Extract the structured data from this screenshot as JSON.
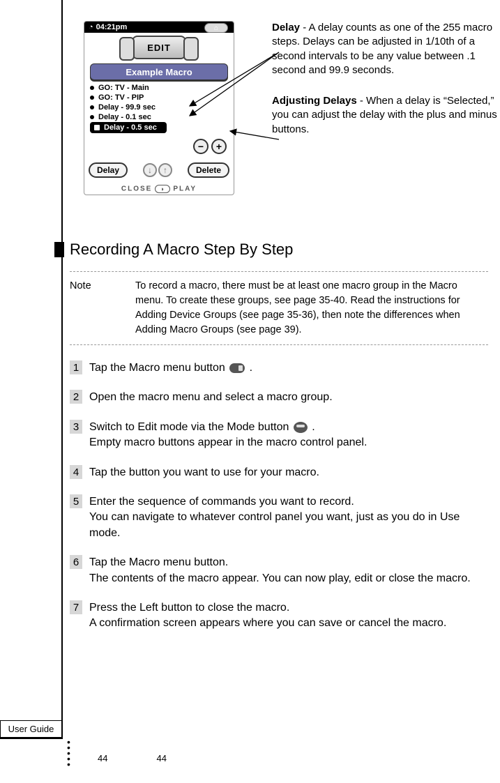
{
  "tab_label": "User Guide",
  "page_number_left": "44",
  "page_number_right": "44",
  "device": {
    "time": "04:21pm",
    "edit_label": "EDIT",
    "title": "Example Macro",
    "rows": [
      "GO: TV - Main",
      "GO: TV - PIP",
      "Delay - 99.9 sec",
      "Delay - 0.1 sec"
    ],
    "selected_row": "Delay - 0.5 sec",
    "minus": "−",
    "plus": "+",
    "btn_delay": "Delay",
    "btn_delete": "Delete",
    "footer_left": "CLOSE",
    "footer_right": "PLAY"
  },
  "callouts": {
    "delay_label": "Delay",
    "delay_text": " - A delay counts as one of the 255 macro steps. Delays can be adjusted in 1/10th of a second intervals to be any value between .1 second and 99.9 seconds.",
    "adjust_label": "Adjusting Delays",
    "adjust_text": " - When a delay is “Selected,” you can adjust the delay with the plus and minus buttons."
  },
  "heading": "Recording A Macro Step By Step",
  "note": {
    "label": "Note",
    "text": "To record a macro, there must be at least one macro group in the Macro menu. To create these groups, see page 35-40. Read the instructions for Adding Device Groups (see page 35-36), then note the differences when Adding Macro Groups (see page 39)."
  },
  "steps": {
    "s1": "Tap the Macro menu button ",
    "s1_after": " .",
    "s2": "Open the macro menu and select a macro group.",
    "s3a": "Switch to Edit mode via the Mode button ",
    "s3b": "  .",
    "s3c": "Empty macro buttons appear in the macro control panel.",
    "s4": "Tap the button you want to use for your macro.",
    "s5a": "Enter the sequence of commands you want to record.",
    "s5b": "You can navigate to whatever control panel you want, just as you do in Use mode.",
    "s6a": "Tap the Macro menu button.",
    "s6b": "The contents of the macro appear. You can now play, edit or close the macro.",
    "s7a": "Press the Left button to close the macro.",
    "s7b": "A confirmation screen appears where you can save or cancel the macro."
  },
  "nums": {
    "n1": "1",
    "n2": "2",
    "n3": "3",
    "n4": "4",
    "n5": "5",
    "n6": "6",
    "n7": "7"
  }
}
